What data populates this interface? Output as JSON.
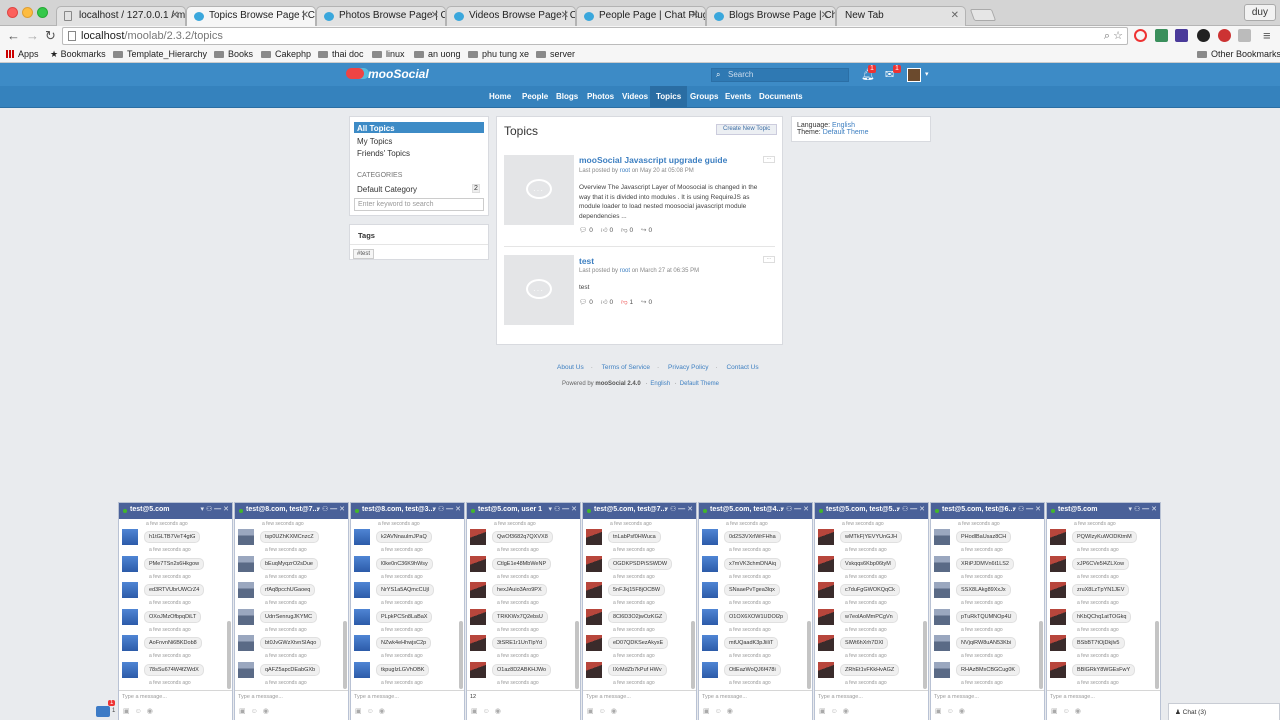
{
  "browser": {
    "tabs": [
      {
        "title": "localhost / 127.0.0.1 / mo",
        "favicon": "page"
      },
      {
        "title": "Topics Browse Page | Chat",
        "favicon": "moo"
      },
      {
        "title": "Photos Browse Page | Chat",
        "favicon": "moo"
      },
      {
        "title": "Videos Browse Page | Chat",
        "favicon": "moo"
      },
      {
        "title": "People Page | Chat Plugins",
        "favicon": "moo"
      },
      {
        "title": "Blogs Browse Page | Chat",
        "favicon": "moo"
      },
      {
        "title": "New Tab",
        "favicon": "none"
      }
    ],
    "user_name": "duy",
    "url_host": "localhost",
    "url_path": "/moolab/2.3.2/topics",
    "bookmarks": [
      "Apps",
      "Bookmarks",
      "Template_Hierarchy",
      "Books",
      "Cakephp",
      "thai doc",
      "linux",
      "an uong",
      "phu tung xe",
      "server"
    ],
    "other_bookmarks": "Other Bookmarks"
  },
  "site": {
    "logo_text": "mooSocial",
    "search_placeholder": "Search",
    "notification_count": "1",
    "message_count": "1",
    "nav": [
      "Home",
      "People",
      "Blogs",
      "Photos",
      "Videos",
      "Topics",
      "Groups",
      "Events",
      "Documents"
    ],
    "active_nav": "Topics"
  },
  "sidebar": {
    "links": [
      "All Topics",
      "My Topics",
      "Friends' Topics"
    ],
    "categories_heading": "CATEGORIES",
    "category_name": "Default Category",
    "category_count": "2",
    "keyword_placeholder": "Enter keyword to search",
    "tags_heading": "Tags",
    "tag": "#test"
  },
  "main": {
    "title": "Topics",
    "create_button": "Create New Topic",
    "topics": [
      {
        "title": "mooSocial Javascript upgrade guide",
        "meta_prefix": "Last posted by ",
        "author": "root",
        "meta_suffix": " on May 20 at 05:08 PM",
        "body": "Overview The Javascript Layer of Moosocial is changed in the way that it is divided into modules . It is using RequireJS as module loader to load nested moosocial javascript module dependencies ...",
        "comments": "0",
        "likes": "0",
        "dislikes": "0",
        "shares": "0"
      },
      {
        "title": "test",
        "meta_prefix": "Last posted by ",
        "author": "root",
        "meta_suffix": " on March 27 at 06:35 PM",
        "body": "test",
        "comments": "0",
        "likes": "0",
        "dislikes": "1",
        "shares": "0"
      }
    ]
  },
  "right_panel": {
    "language_label": "Language: ",
    "language_value": "English",
    "theme_label": "Theme: ",
    "theme_value": "Default Theme"
  },
  "footer": {
    "links": [
      "About Us",
      "Terms of Service",
      "Privacy Policy",
      "Contact Us"
    ],
    "powered_prefix": "Powered by ",
    "powered_brand": "mooSocial 2.4.0",
    "language": "English",
    "theme": "Default Theme"
  },
  "chat": {
    "timestamp": "a few seconds ago",
    "input_placeholder": "Type a message...",
    "dock_count": "1",
    "dock_badge": "1",
    "chat_label": "Chat (3)",
    "windows": [
      {
        "title": "test@5.com",
        "avatar": "blue",
        "typed": "",
        "messages": [
          "h1tGLTB7VeT4gtG",
          "PMe7TSn2s6Hkgow",
          "ed3RTVUbrUWCrZ4",
          "OXoJMzOfbpqDiLT",
          "AoFnvnNi6BKDob8",
          "78sSu674W4fZWdX"
        ]
      },
      {
        "title": "test@8.com, test@7...",
        "avatar": "bars",
        "typed": "",
        "messages": [
          "tsp0UZhKXMCnzcZ",
          "bEuqMyqzrO2sDue",
          "rfAq8pcchUGaoeq",
          "UdrrSenrugJKYMC",
          "bt0JvGWzXtvnSIAqo",
          "qAFZ5apcDEabGXb"
        ]
      },
      {
        "title": "test@8.com, test@3...",
        "avatar": "blue",
        "typed": "",
        "messages": [
          "k2AVNnauImJPaQ",
          "l0ke0nC36K9hWsy",
          "NrYS1a5AQmcCUjl",
          "PLpkPCSn8LaBaX",
          "NZwk4eHhwjsC2p",
          "tkpugIzLGVhOBK"
        ]
      },
      {
        "title": "test@5.com, user 1",
        "avatar": "red",
        "typed": "12",
        "messages": [
          "QwOf3682q7QXVX8",
          "CtlgE1e48MbWeNP",
          "hexJAuio3Aro9PX",
          "TRKKWx7Q2ebsU",
          "3tSRE1r1UnTlpYd",
          "O1az8D2ABKHJWo"
        ]
      },
      {
        "title": "test@5.com, test@7...",
        "avatar": "red",
        "typed": "",
        "messages": [
          "tnLabPsf0HWuca",
          "OGDKPSDPiSSWDW",
          "5nFJkj15F8jOCBW",
          "8Cl6D3O2jwOzKGZ",
          "eD07QDKSezAkyxE",
          "IXrMdZb7kPuf HWv"
        ]
      },
      {
        "title": "test@5.com, test@4...",
        "avatar": "blue",
        "typed": "",
        "messages": [
          "0d2S3VXrlWrFHha",
          "x7mVK3chmDNAiq",
          "SNaaePvTgea3lqx",
          "O1OX6XOW1UDOl2p",
          "mtUQaadK3pJiiliT",
          "OtlEazWoQJ6f478i"
        ]
      },
      {
        "title": "test@5.com, test@5...",
        "avatar": "red",
        "typed": "",
        "messages": [
          "wMTkF|YEVYUnGJH",
          "Vskqqs6Kbp06tyM",
          "c7duFgGWOKQqCk",
          "w7eolAoMmPCgVn",
          "SlWt6hXrh7DXl",
          "ZRhEt1vFKkHvAGZ"
        ]
      },
      {
        "title": "test@5.com, test@6...",
        "avatar": "bars",
        "typed": "",
        "messages": [
          "PHodlBaUsaz8CH",
          "XRiPJDMVn6t1LS2",
          "SSX8LAkg89XxJx",
          "pTuRkTQUMNOp4U",
          "NVjqiRW8uAN53Kbi",
          "RHAzBMxCBGCug0K"
        ]
      },
      {
        "title": "test@5.com",
        "avatar": "red",
        "typed": "",
        "messages": [
          "PQWIzyKuWODKtmM",
          "xJP6CVe5l4ZLXow",
          "zruX8LzTpYN1JEV",
          "hKbQChq1atTOGkq",
          "BSbBT7tOjDkjlv5",
          "BBlGRkY8WGEsFwY"
        ]
      }
    ]
  }
}
